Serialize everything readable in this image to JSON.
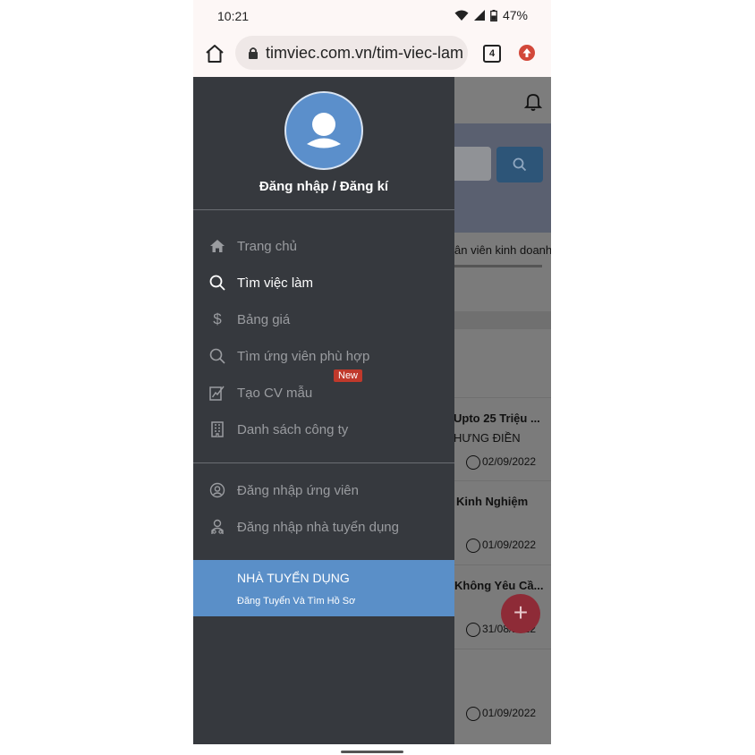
{
  "status_bar": {
    "time": "10:21",
    "battery": "47%"
  },
  "browser": {
    "url": "timviec.com.vn/tim-viec-lam",
    "tab_count": "4"
  },
  "drawer": {
    "login_label": "Đăng nhập / Đăng kí",
    "menu": [
      {
        "label": "Trang chủ",
        "icon": "home-icon"
      },
      {
        "label": "Tìm việc làm",
        "icon": "search-icon",
        "active": true
      },
      {
        "label": "Bảng giá",
        "icon": "dollar-icon"
      },
      {
        "label": "Tìm ứng viên phù hợp",
        "icon": "search-icon"
      },
      {
        "label": "Tạo CV mẫu",
        "icon": "cv-edit-icon",
        "badge": "New"
      },
      {
        "label": "Danh sách công ty",
        "icon": "building-icon"
      }
    ],
    "account": [
      {
        "label": "Đăng nhập ứng viên",
        "icon": "user-circle-icon"
      },
      {
        "label": "Đăng nhập nhà tuyển dụng",
        "icon": "employer-icon"
      }
    ],
    "employer_banner": {
      "title": "NHÀ TUYỂN DỤNG",
      "subtitle": "Đăng Tuyển Và Tìm Hồ Sơ"
    }
  },
  "background": {
    "breadcrumb_text": "ân viên kinh doanh",
    "jobs": [
      {
        "title": "Upto 25 Triệu ...",
        "company": "HƯNG ĐIỀN",
        "date": "02/09/2022"
      },
      {
        "title": "Kinh Nghiệm",
        "company": "",
        "date": "01/09/2022"
      },
      {
        "title": "Không Yêu Cầ...",
        "company": "",
        "date": "31/08/2022"
      },
      {
        "title": "",
        "company": "",
        "date": "01/09/2022"
      }
    ]
  },
  "colors": {
    "drawer_bg": "#36393e",
    "accent_blue": "#5a8fc8",
    "badge_red": "#c0392b"
  }
}
